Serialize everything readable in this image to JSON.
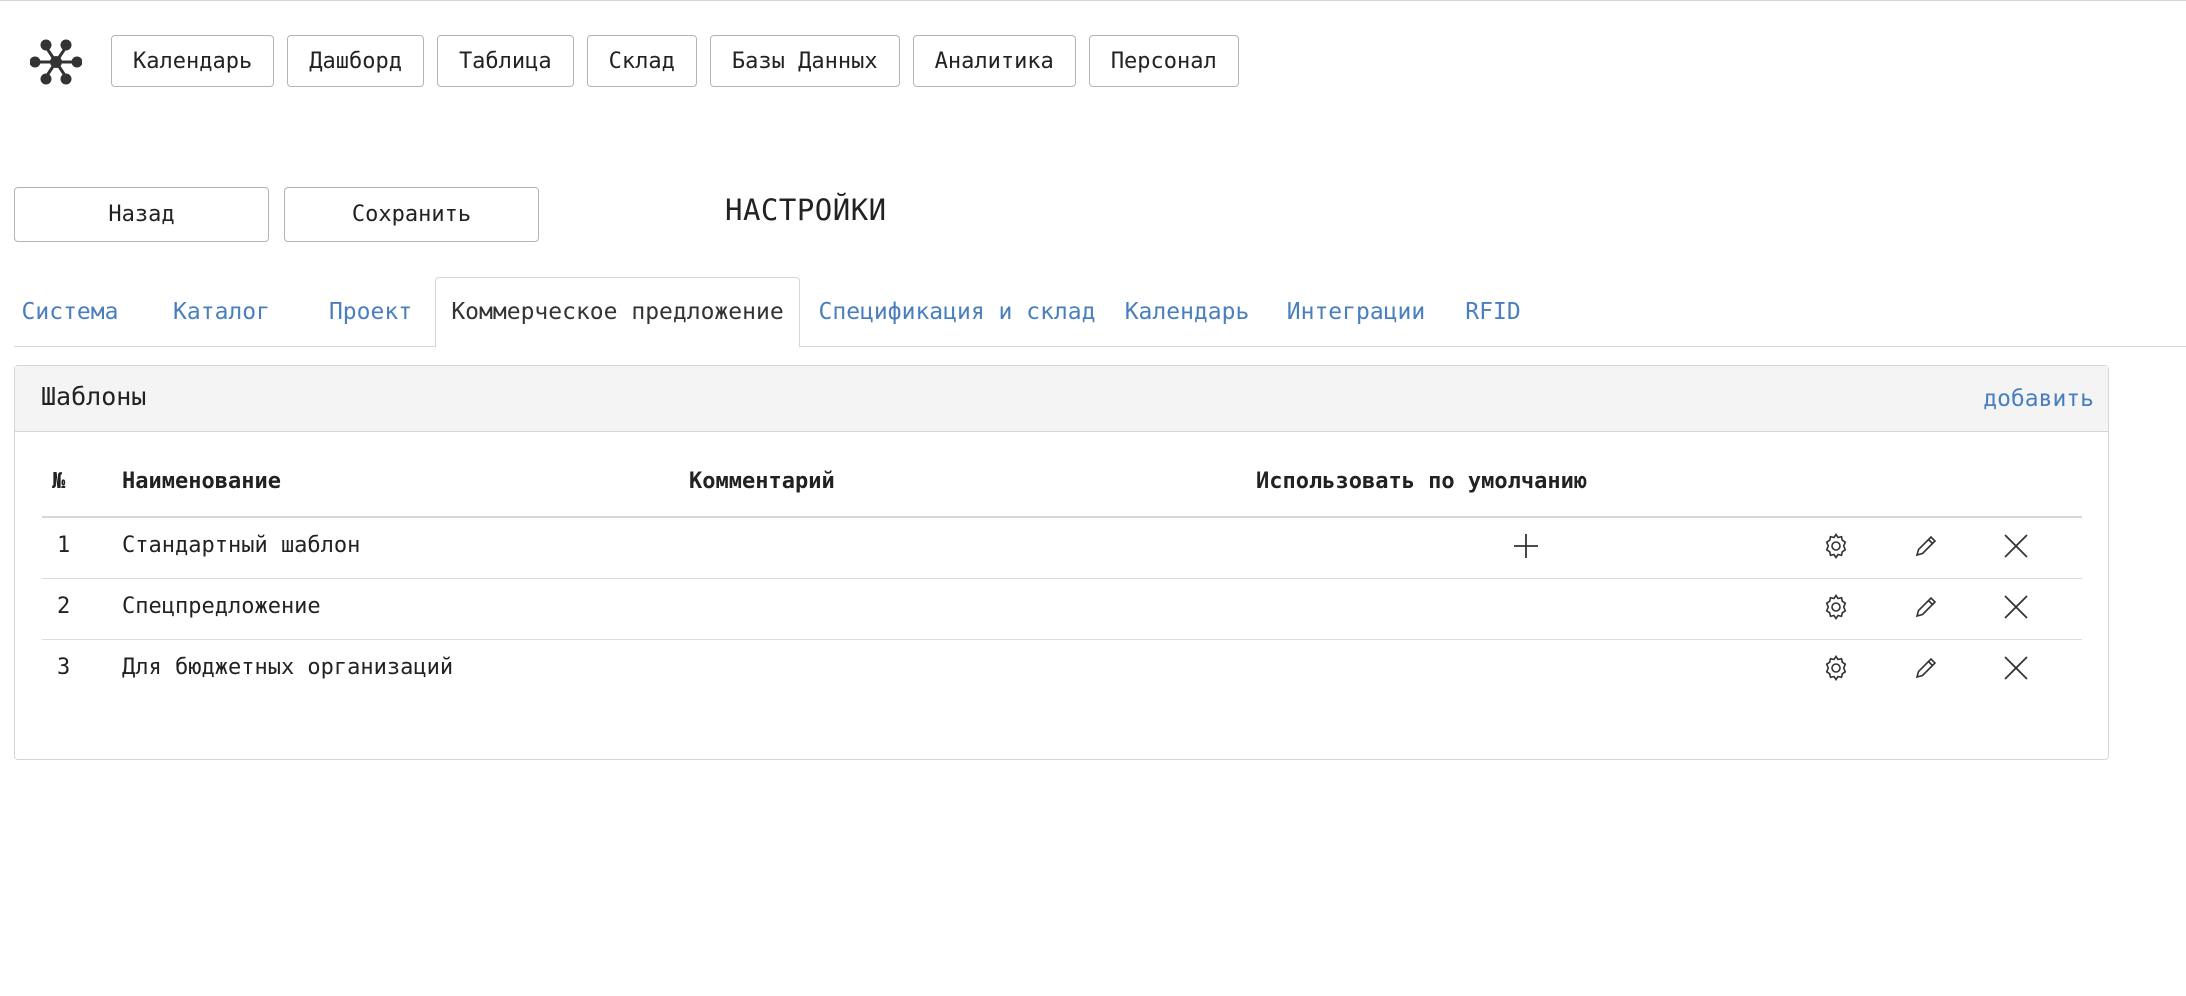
{
  "nav": {
    "items": [
      {
        "label": "Календарь"
      },
      {
        "label": "Дашборд"
      },
      {
        "label": "Таблица"
      },
      {
        "label": "Склад"
      },
      {
        "label": "Базы Данных"
      },
      {
        "label": "Аналитика"
      },
      {
        "label": "Персонал"
      }
    ]
  },
  "actions": {
    "back_label": "Назад",
    "save_label": "Сохранить"
  },
  "page": {
    "title": "НАСТРОЙКИ"
  },
  "tabs": [
    {
      "label": "Система"
    },
    {
      "label": "Каталог"
    },
    {
      "label": "Проект"
    },
    {
      "label": "Коммерческое предложение",
      "active": true
    },
    {
      "label": "Спецификация и склад"
    },
    {
      "label": "Календарь"
    },
    {
      "label": "Интеграции"
    },
    {
      "label": "RFID"
    }
  ],
  "panel": {
    "title": "Шаблоны",
    "add_label": "добавить"
  },
  "table": {
    "headers": {
      "num": "№",
      "name": "Наименование",
      "comment": "Комментарий",
      "default": "Использовать по умолчанию"
    },
    "rows": [
      {
        "num": "1",
        "name": "Стандартный шаблон",
        "comment": "",
        "is_default": true
      },
      {
        "num": "2",
        "name": "Спецпредложение",
        "comment": "",
        "is_default": false
      },
      {
        "num": "3",
        "name": "Для бюджетных организаций",
        "comment": "",
        "is_default": false
      }
    ]
  },
  "icons": {
    "logo": "molecule-logo-icon",
    "default_marker": "plus-icon",
    "settings": "gear-icon",
    "edit": "pencil-icon",
    "delete": "close-icon"
  },
  "colors": {
    "link": "#4a7fbf",
    "border": "#d6d6d6",
    "panel_header_bg": "#f4f4f4"
  }
}
